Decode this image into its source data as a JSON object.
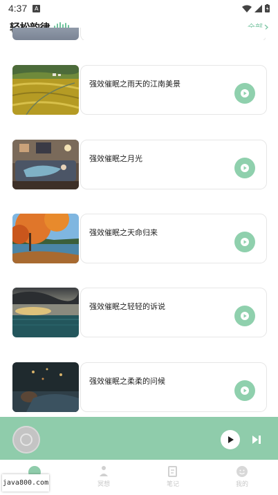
{
  "status_bar": {
    "time": "4:37",
    "notif": "A"
  },
  "header": {
    "title": "轻松韵律",
    "more": "全部"
  },
  "items": [
    {
      "title": "强效催眠之雨天的江南美景",
      "thumb": "rice-terraces"
    },
    {
      "title": "强效催眠之月光",
      "thumb": "sofa-sleeper"
    },
    {
      "title": "强效催眠之天命归来",
      "thumb": "autumn-lake"
    },
    {
      "title": "强效催眠之轻轻的诉说",
      "thumb": "storm-sea"
    },
    {
      "title": "强效催眠之柔柔的问候",
      "thumb": "bed-sleeper"
    }
  ],
  "tabs": [
    {
      "label": "",
      "icon": "home-icon"
    },
    {
      "label": "冥想",
      "icon": "meditation-icon"
    },
    {
      "label": "笔记",
      "icon": "notes-icon"
    },
    {
      "label": "我的",
      "icon": "profile-icon"
    }
  ],
  "watermark": "java800.com",
  "colors": {
    "accent": "#8fccab",
    "play": "#8fd0ad",
    "link": "#7cc6a4"
  }
}
